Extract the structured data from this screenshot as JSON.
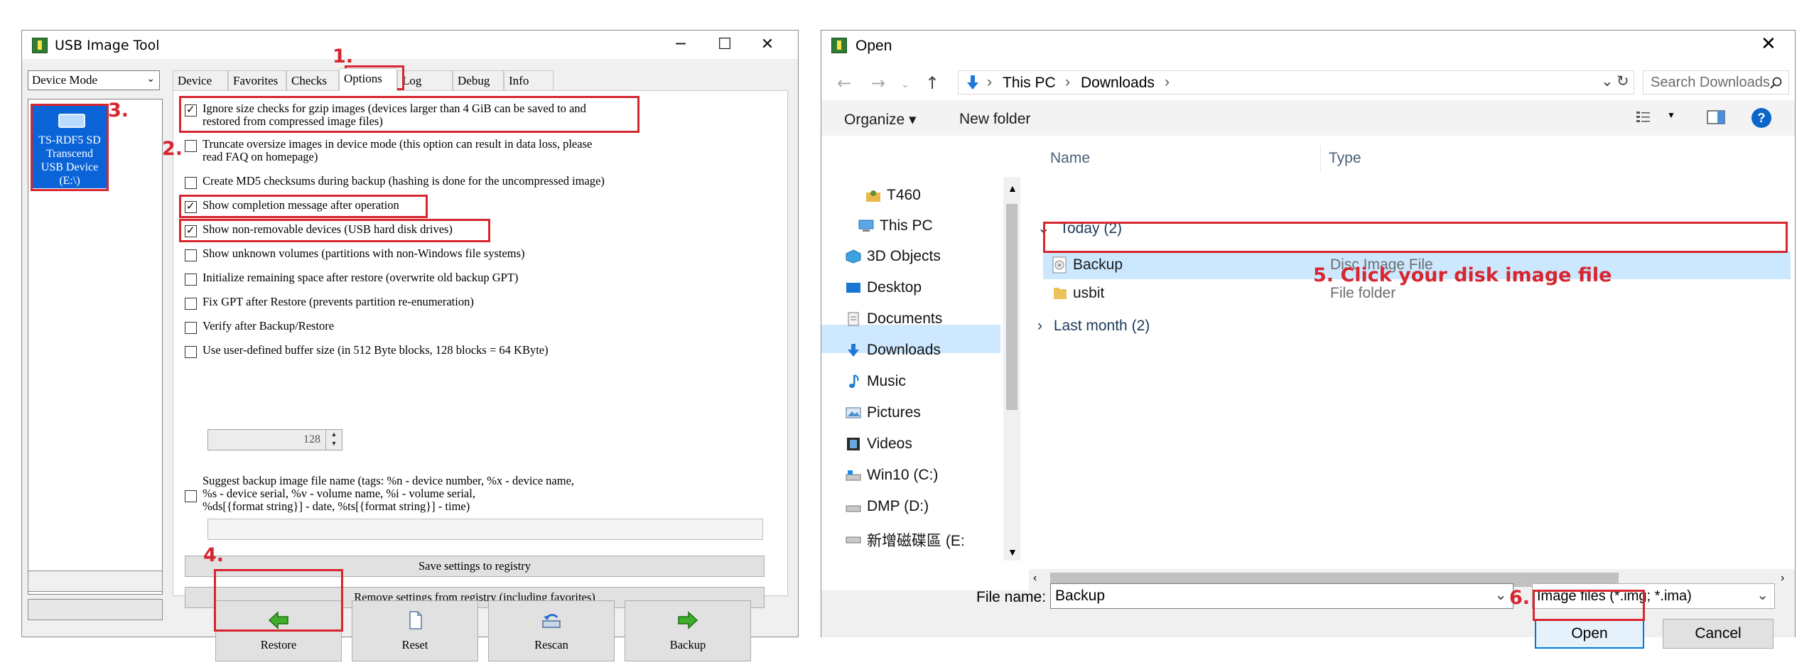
{
  "usb_tool": {
    "title": "USB Image Tool",
    "window_controls": {
      "minimize": "─",
      "maximize": "☐",
      "close": "✕"
    },
    "mode_select": "Device Mode",
    "device": {
      "name_line1": "TS-RDF5 SD",
      "name_line2": "Transcend",
      "name_line3": "USB Device",
      "name_line4": "(E:\\)"
    },
    "tabs": [
      {
        "label": "Device"
      },
      {
        "label": "Favorites"
      },
      {
        "label": "Checks"
      },
      {
        "label": "Options",
        "active": true
      },
      {
        "label": "Log"
      },
      {
        "label": "Debug"
      },
      {
        "label": "Info"
      }
    ],
    "options": [
      {
        "line1": "Ignore size checks for gzip images (devices larger than 4 GiB can be saved to and",
        "line2": "restored from compressed image files)",
        "checked": true
      },
      {
        "line1": "Truncate oversize images in device mode (this option can result in data loss, please",
        "line2": "read FAQ on homepage)",
        "checked": false
      },
      {
        "line1": "Create MD5 checksums during backup (hashing is done for the uncompressed image)",
        "checked": false
      },
      {
        "line1": "Show completion message after operation",
        "checked": true
      },
      {
        "line1": "Show non-removable devices (USB hard disk drives)",
        "checked": true
      },
      {
        "line1": "Show unknown volumes (partitions with non-Windows file systems)",
        "checked": false
      },
      {
        "line1": "Initialize remaining space after restore (overwrite old backup GPT)",
        "checked": false
      },
      {
        "line1": "Fix GPT after Restore (prevents partition re-enumeration)",
        "checked": false
      },
      {
        "line1": "Verify after Backup/Restore",
        "checked": false
      },
      {
        "line1": "Use user-defined buffer size (in 512 Byte blocks, 128 blocks = 64 KByte)",
        "checked": false
      },
      {
        "line1": "Suggest backup image file name (tags: %n - device number, %x - device name,",
        "line2": "%s - device serial, %v - volume name, %i - volume serial,",
        "line3": "%ds[{format string}] - date, %ts[{format string}] - time)",
        "checked": false
      }
    ],
    "buffer_value": "128",
    "save_settings_label": "Save settings to registry",
    "remove_settings_label": "Remove settings from registry (including favorites)",
    "buttons": {
      "restore": "Restore",
      "reset": "Reset",
      "rescan": "Rescan",
      "backup": "Backup"
    }
  },
  "open_dialog": {
    "title": "Open",
    "close_glyph": "✕",
    "breadcrumb": [
      "This PC",
      "Downloads"
    ],
    "search_placeholder": "Search Downloads",
    "organize_label": "Organize ▾",
    "new_folder_label": "New folder",
    "nav_items": [
      {
        "label": "T460",
        "icon": "user-folder-icon"
      },
      {
        "label": "This PC",
        "icon": "computer-icon"
      },
      {
        "label": "3D Objects",
        "icon": "cube-icon"
      },
      {
        "label": "Desktop",
        "icon": "desktop-icon"
      },
      {
        "label": "Documents",
        "icon": "document-icon"
      },
      {
        "label": "Downloads",
        "icon": "download-icon",
        "selected": true
      },
      {
        "label": "Music",
        "icon": "music-icon"
      },
      {
        "label": "Pictures",
        "icon": "picture-icon"
      },
      {
        "label": "Videos",
        "icon": "video-icon"
      },
      {
        "label": "Win10 (C:)",
        "icon": "drive-icon"
      },
      {
        "label": "DMP (D:)",
        "icon": "drive-icon"
      },
      {
        "label": "新增磁碟區 (E:",
        "icon": "drive-icon"
      }
    ],
    "columns": {
      "name": "Name",
      "type": "Type"
    },
    "groups": {
      "today": "Today (2)",
      "last_month": "Last month (2)"
    },
    "files": [
      {
        "name": "Backup",
        "type": "Disc Image File",
        "selected": true
      },
      {
        "name": "usbit",
        "type": "File folder"
      }
    ],
    "file_name_label": "File name:",
    "file_name_value": "Backup",
    "file_type_value": "Image files (*.img; *.ima)",
    "open_label": "Open",
    "cancel_label": "Cancel"
  },
  "annotations": {
    "step1": "1.",
    "step2": "2.",
    "step3": "3.",
    "step4": "4.",
    "step5": "5. Click your disk image file",
    "step6": "6.",
    "color": "#d7262f"
  }
}
